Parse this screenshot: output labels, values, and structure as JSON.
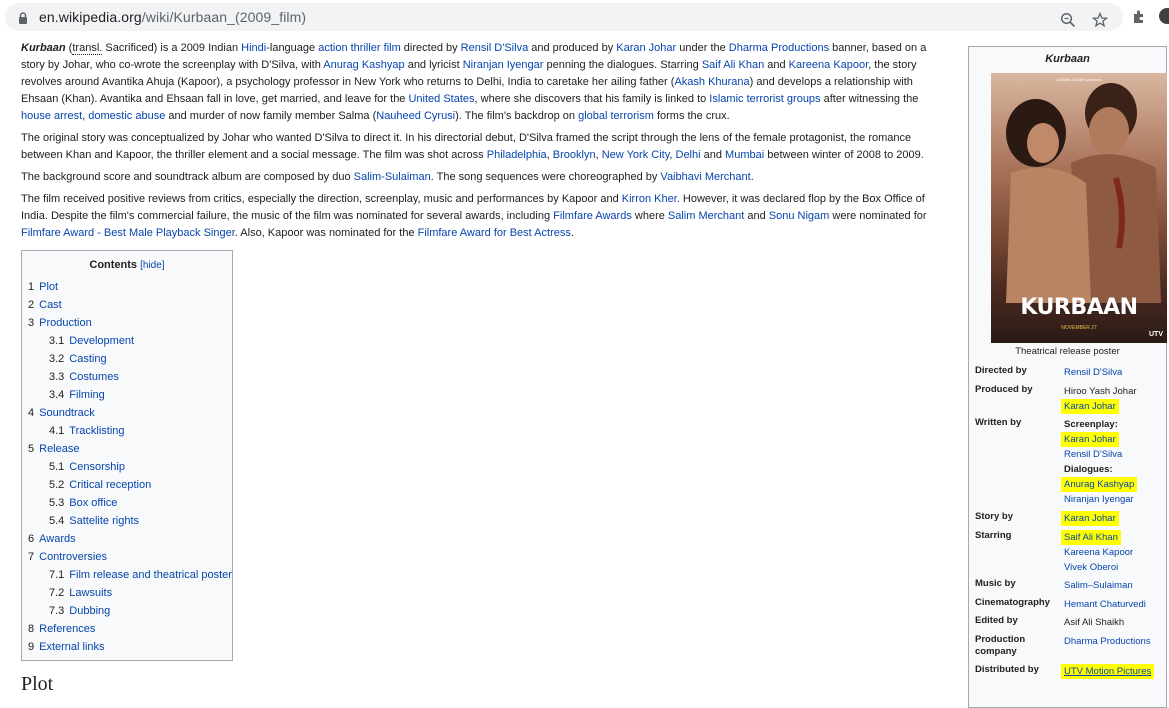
{
  "browser": {
    "url_host": "en.wikipedia.org",
    "url_path": "/wiki/Kurbaan_(2009_film)",
    "icons": [
      "lock-icon",
      "zoom-icon",
      "star-icon",
      "extensions-icon",
      "profile-icon"
    ]
  },
  "article": {
    "p1": {
      "title": "Kurbaan",
      "transl": "transl.",
      "t1": " Sacrificed) is a 2009 Indian ",
      "hindi": "Hindi",
      "t2": "-language ",
      "thriller": "action thriller film",
      "t3": " directed by ",
      "rensil": "Rensil D'Silva",
      "t4": " and produced by ",
      "karan": "Karan Johar",
      "t5": " under the ",
      "dharma": "Dharma Productions",
      "t6": " banner, based on a story by Johar, who co-wrote the screenplay with D'Silva, with ",
      "anurag": "Anurag Kashyap",
      "t7": " and lyricist ",
      "niranjan": "Niranjan Iyengar",
      "t8": " penning the dialogues. Starring ",
      "saif": "Saif Ali Khan",
      "t9": " and ",
      "kareena": "Kareena Kapoor",
      "t10": ", the story revolves around Avantika Ahuja (Kapoor), a psychology professor in New York who returns to Delhi, India to caretake her ailing father (",
      "akash": "Akash Khurana",
      "t11": ") and develops a relationship with Ehsaan (Khan). Avantika and Ehsaan fall in love, get married, and leave for the ",
      "us": "United States",
      "t12": ", where she discovers that his family is linked to ",
      "islamic": "Islamic terrorist groups",
      "t13": " after witnessing the ",
      "house": "house arrest",
      "t14": ", ",
      "domestic": "domestic abuse",
      "t15": " and murder of now family member Salma (",
      "nauheed": "Nauheed Cyrusi",
      "t16": "). The film's backdrop on ",
      "global": "global terrorism",
      "t17": " forms the crux."
    },
    "p2": {
      "t1": "The original story was conceptualized by Johar who wanted D'Silva to direct it. In his directorial debut, D'Silva framed the script through the lens of the female protagonist, the romance between Khan and Kapoor, the thriller element and a social message. The film was shot across ",
      "phil": "Philadelphia",
      "c1": ", ",
      "brooklyn": "Brooklyn",
      "c2": ", ",
      "nyc": "New York City",
      "c3": ", ",
      "delhi": "Delhi",
      "t2": " and ",
      "mumbai": "Mumbai",
      "t3": " between winter of 2008 to 2009."
    },
    "p3": {
      "t1": "The background score and soundtrack album are composed by duo ",
      "ss": "Salim-Sulaiman",
      "t2": ". The song sequences were choreographed by ",
      "vaibhavi": "Vaibhavi Merchant",
      "t3": "."
    },
    "p4": {
      "t1": "The film received positive reviews from critics, especially the direction, screenplay, music and performances by Kapoor and ",
      "kirron": "Kirron Kher",
      "t2": ". However, it was declared flop by the Box Office of India. Despite the film's commercial failure, the music of the film was nominated for several awards, including ",
      "filmfare": "Filmfare Awards",
      "t3": " where ",
      "salim": "Salim Merchant",
      "t4": " and ",
      "sonu": "Sonu Nigam",
      "t5": " were nominated for ",
      "bmps": "Filmfare Award - Best Male Playback Singer",
      "t6": ". Also, Kapoor was nominated for the ",
      "bestactress": "Filmfare Award for Best Actress",
      "t7": "."
    }
  },
  "toc": {
    "title": "Contents",
    "hide": "[hide]",
    "items": [
      {
        "num": "1",
        "label": "Plot",
        "level": 1
      },
      {
        "num": "2",
        "label": "Cast",
        "level": 1
      },
      {
        "num": "3",
        "label": "Production",
        "level": 1
      },
      {
        "num": "3.1",
        "label": "Development",
        "level": 2
      },
      {
        "num": "3.2",
        "label": "Casting",
        "level": 2
      },
      {
        "num": "3.3",
        "label": "Costumes",
        "level": 2
      },
      {
        "num": "3.4",
        "label": "Filming",
        "level": 2
      },
      {
        "num": "4",
        "label": "Soundtrack",
        "level": 1
      },
      {
        "num": "4.1",
        "label": "Tracklisting",
        "level": 2
      },
      {
        "num": "5",
        "label": "Release",
        "level": 1
      },
      {
        "num": "5.1",
        "label": "Censorship",
        "level": 2
      },
      {
        "num": "5.2",
        "label": "Critical reception",
        "level": 2
      },
      {
        "num": "5.3",
        "label": "Box office",
        "level": 2
      },
      {
        "num": "5.4",
        "label": "Sattelite rights",
        "level": 2
      },
      {
        "num": "6",
        "label": "Awards",
        "level": 1
      },
      {
        "num": "7",
        "label": "Controversies",
        "level": 1
      },
      {
        "num": "7.1",
        "label": "Film release and theatrical poster",
        "level": 2
      },
      {
        "num": "7.2",
        "label": "Lawsuits",
        "level": 2
      },
      {
        "num": "7.3",
        "label": "Dubbing",
        "level": 2
      },
      {
        "num": "8",
        "label": "References",
        "level": 1
      },
      {
        "num": "9",
        "label": "External links",
        "level": 1
      }
    ]
  },
  "next_heading": "Plot",
  "infobox": {
    "title": "Kurbaan",
    "poster_title": "KURBAAN",
    "poster_credit": "KARAN JOHAR presents",
    "poster_date": "NOVEMBER 27",
    "poster_logo": "UTV",
    "caption": "Theatrical release poster",
    "directed_by": {
      "label": "Directed by",
      "value": "Rensil D'Silva"
    },
    "produced_by": {
      "label": "Produced by",
      "v1": "Hiroo Yash Johar",
      "v2": "Karan Johar"
    },
    "written_by": {
      "label": "Written by",
      "sub1": "Screenplay:",
      "v1": "Karan Johar",
      "v2": "Rensil D'Silva",
      "sub2": "Dialogues:",
      "v3": "Anurag Kashyap",
      "v4": "Niranjan Iyengar"
    },
    "story_by": {
      "label": "Story by",
      "value": "Karan Johar"
    },
    "starring": {
      "label": "Starring",
      "v1": "Saif Ali Khan",
      "v2": "Kareena Kapoor",
      "v3": "Vivek Oberoi"
    },
    "music_by": {
      "label": "Music by",
      "value": "Salim–Sulaiman"
    },
    "cinematography": {
      "label": "Cinematography",
      "value": "Hemant Chaturvedi"
    },
    "edited_by": {
      "label": "Edited by",
      "value": "Asif Ali Shaikh"
    },
    "production_company": {
      "label": "Production company",
      "value": "Dharma Productions"
    },
    "distributed_by": {
      "label": "Distributed by",
      "value": "UTV Motion Pictures"
    }
  },
  "colors": {
    "link": "#0645ad",
    "highlight": "#ffff00",
    "border": "#a2a9b1",
    "box_bg": "#f8f9fa"
  }
}
